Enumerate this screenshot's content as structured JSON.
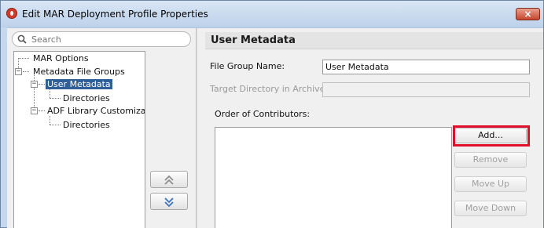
{
  "window": {
    "title": "Edit MAR Deployment Profile Properties",
    "close_label": "×"
  },
  "search": {
    "placeholder": "Search"
  },
  "tree": {
    "items": [
      {
        "label": "MAR Options"
      },
      {
        "label": "Metadata File Groups",
        "expanded": true
      },
      {
        "label": "User Metadata",
        "expanded": true,
        "selected": true
      },
      {
        "label": "Directories"
      },
      {
        "label": "ADF Library Customization",
        "expanded": true
      },
      {
        "label": "Directories"
      }
    ]
  },
  "reorder": {
    "up_icon": "double-chevron-up-icon",
    "down_icon": "double-chevron-down-icon"
  },
  "section": {
    "title": "User Metadata"
  },
  "form": {
    "file_group_name_label": "File Group Name:",
    "file_group_name_value": "User Metadata",
    "target_directory_label": "Target Directory in Archive:",
    "target_directory_value": "",
    "contributors_label": "Order of Contributors:"
  },
  "buttons": {
    "add": "Add...",
    "remove": "Remove",
    "move_up": "Move Up",
    "move_down": "Move Down"
  },
  "colors": {
    "selection": "#2f5f98",
    "highlight": "#e0102a",
    "titlebar": "#c6d8ee"
  }
}
